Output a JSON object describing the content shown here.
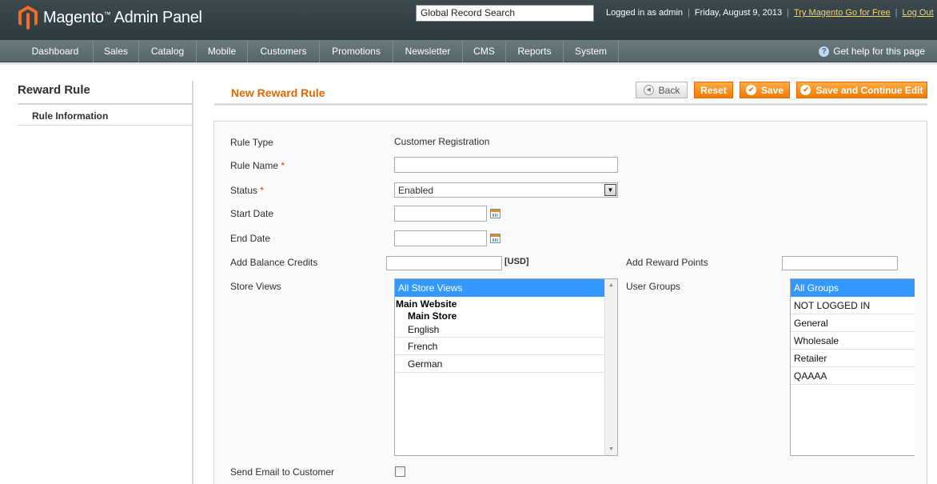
{
  "header": {
    "logo_brand": "Magento",
    "logo_suffix": "Admin Panel",
    "logo_tm": "™",
    "search_value": "Global Record Search",
    "logged_in": "Logged in as admin",
    "date": "Friday, August 9, 2013",
    "try_link": "Try Magento Go for Free",
    "logout": "Log Out"
  },
  "nav": {
    "items": [
      "Dashboard",
      "Sales",
      "Catalog",
      "Mobile",
      "Customers",
      "Promotions",
      "Newsletter",
      "CMS",
      "Reports",
      "System"
    ],
    "help": "Get help for this page"
  },
  "sidebar": {
    "title": "Reward Rule",
    "tab": "Rule Information"
  },
  "page": {
    "title": "New Reward Rule",
    "buttons": {
      "back": "Back",
      "reset": "Reset",
      "save": "Save",
      "save_continue": "Save and Continue Edit"
    }
  },
  "form": {
    "rule_type_label": "Rule Type",
    "rule_type_value": "Customer Registration",
    "rule_name_label": "Rule Name",
    "rule_name_value": "",
    "status_label": "Status",
    "status_value": "Enabled",
    "required_mark": "*",
    "start_date_label": "Start Date",
    "end_date_label": "End Date",
    "balance_label": "Add Balance Credits",
    "currency": "[USD]",
    "reward_points_label": "Add Reward Points",
    "store_views_label": "Store Views",
    "store_views": {
      "all": "All Store Views",
      "website": "Main Website",
      "store": "Main Store",
      "views": [
        "English",
        "French",
        "German"
      ]
    },
    "user_groups_label": "User Groups",
    "user_groups": [
      "All Groups",
      "NOT LOGGED IN",
      "General",
      "Wholesale",
      "Retailer",
      "QAAAA"
    ],
    "send_email_label": "Send Email to Customer"
  },
  "colors": {
    "accent": "#e26703",
    "button": "#f07b00",
    "header": "#2c3a3f",
    "selection": "#3399ff"
  }
}
